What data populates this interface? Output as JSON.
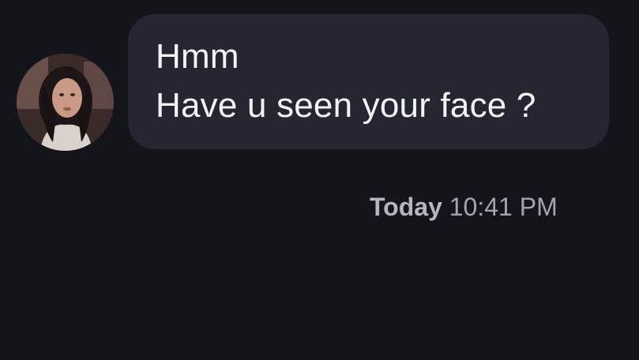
{
  "conversation": {
    "message": {
      "lines": [
        "Hmm",
        "Have u seen your face ?"
      ]
    },
    "timestamp": {
      "day": "Today",
      "time": "10:41 PM"
    }
  },
  "colors": {
    "background": "#13151a",
    "bubble": "#242731",
    "message_text": "#f2f3f5",
    "timestamp_text": "#a2a5ae"
  }
}
